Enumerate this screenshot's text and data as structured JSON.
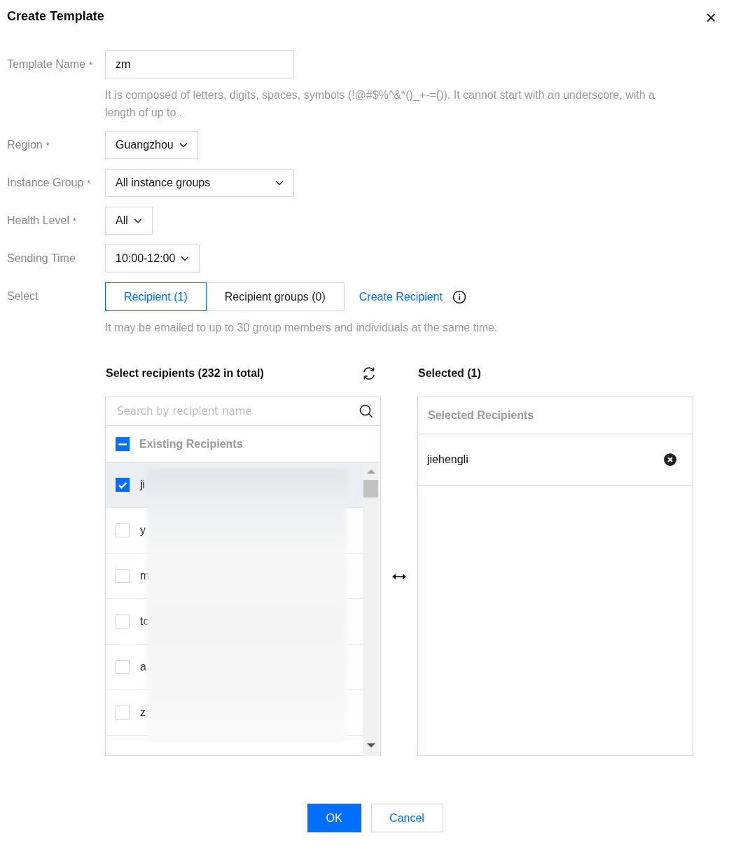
{
  "dialog": {
    "title": "Create Template",
    "close": "×"
  },
  "fields": [
    {
      "kind": "input",
      "label": "Template Name",
      "mark": "*",
      "value": "zm",
      "hint": "It is composed of letters, digits, spaces, symbols (!@#$%^&*()_+-=()). It cannot start with an underscore, with a length of up to ."
    },
    {
      "kind": "select",
      "label": "Region",
      "mark": "*",
      "value": "Guangzhou"
    },
    {
      "kind": "wide-select",
      "label": "Instance Group",
      "mark": "*",
      "value": "All instance groups"
    },
    {
      "kind": "select",
      "label": "Health Level",
      "mark": "*",
      "value": "All"
    },
    {
      "kind": "select",
      "label": "Sending Time",
      "value": "10:00-12:00"
    }
  ],
  "select": {
    "label": "Select",
    "tabs": [
      {
        "label": "Recipient (1)",
        "selected": true
      },
      {
        "label": "Recipient groups (0)",
        "selected": false
      }
    ],
    "link": "Create Recipient",
    "hint": "It may be emailed to up to 30 group members and individuals at the same time."
  },
  "source": {
    "title": "Select recipients (232 in total)",
    "placeholder": "Search by recipient name",
    "group": {
      "label": "Existing Recipients",
      "partial": true
    },
    "rows": [
      {
        "label": "ji",
        "checked": true
      },
      {
        "label": "y",
        "checked": false
      },
      {
        "label": "m",
        "checked": false
      },
      {
        "label": "tc",
        "checked": false
      },
      {
        "label": "a",
        "checked": false
      },
      {
        "label": "z",
        "checked": false
      }
    ]
  },
  "target": {
    "title": "Selected (1)",
    "header": "Selected Recipients",
    "items": [
      "jiehengli"
    ]
  },
  "buttons": [
    {
      "label": "OK",
      "primary": true
    },
    {
      "label": "Cancel",
      "primary": false
    }
  ]
}
